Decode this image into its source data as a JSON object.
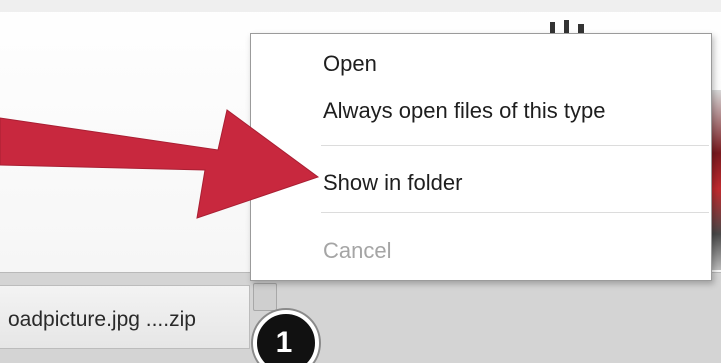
{
  "context_menu": {
    "open_label": "Open",
    "always_open_label": "Always open files of this type",
    "show_in_folder_label": "Show in folder",
    "cancel_label": "Cancel"
  },
  "download_shelf": {
    "file_name": "oadpicture.jpg ....zip"
  },
  "annotation": {
    "step_number": "1",
    "arrow_color": "#c8283e",
    "icon": "arrow-pointer-icon"
  }
}
